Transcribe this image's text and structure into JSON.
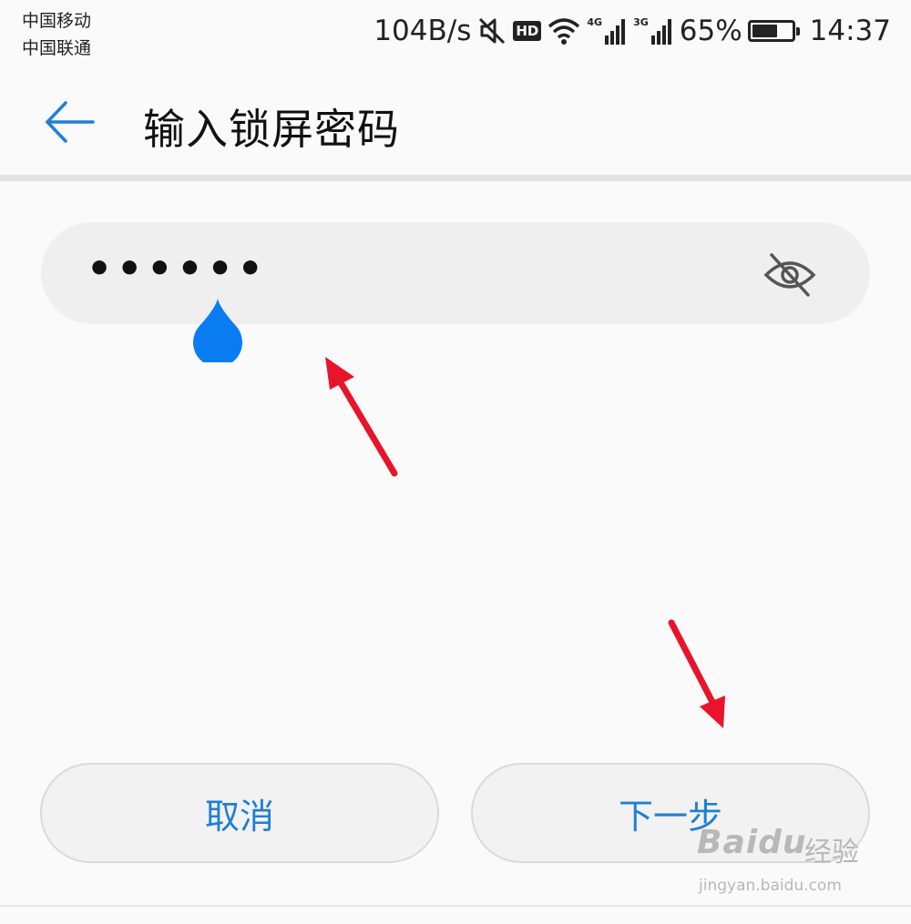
{
  "status_bar": {
    "carrier_1": "中国移动",
    "carrier_2": "中国联通",
    "net_speed": "104B/s",
    "hd_badge": "HD",
    "sim1_network": "4G",
    "sim2_network": "3G",
    "battery_percent": "65%",
    "battery_level": 0.65,
    "time": "14:37"
  },
  "header": {
    "title": "输入锁屏密码"
  },
  "password_field": {
    "masked_value": "••••••"
  },
  "buttons": {
    "cancel_label": "取消",
    "next_label": "下一步"
  },
  "watermark": {
    "logo_text": "Baidu",
    "brand_cn": "经验",
    "url": "jingyan.baidu.com"
  },
  "colors": {
    "accent": "#1e7fd6",
    "cursor_handle": "#0a7cf2",
    "annotation_arrow": "#e8142b"
  },
  "icons": [
    "back-arrow-icon",
    "mute-icon",
    "wifi-icon",
    "signal-icon",
    "battery-icon",
    "eye-off-icon"
  ]
}
